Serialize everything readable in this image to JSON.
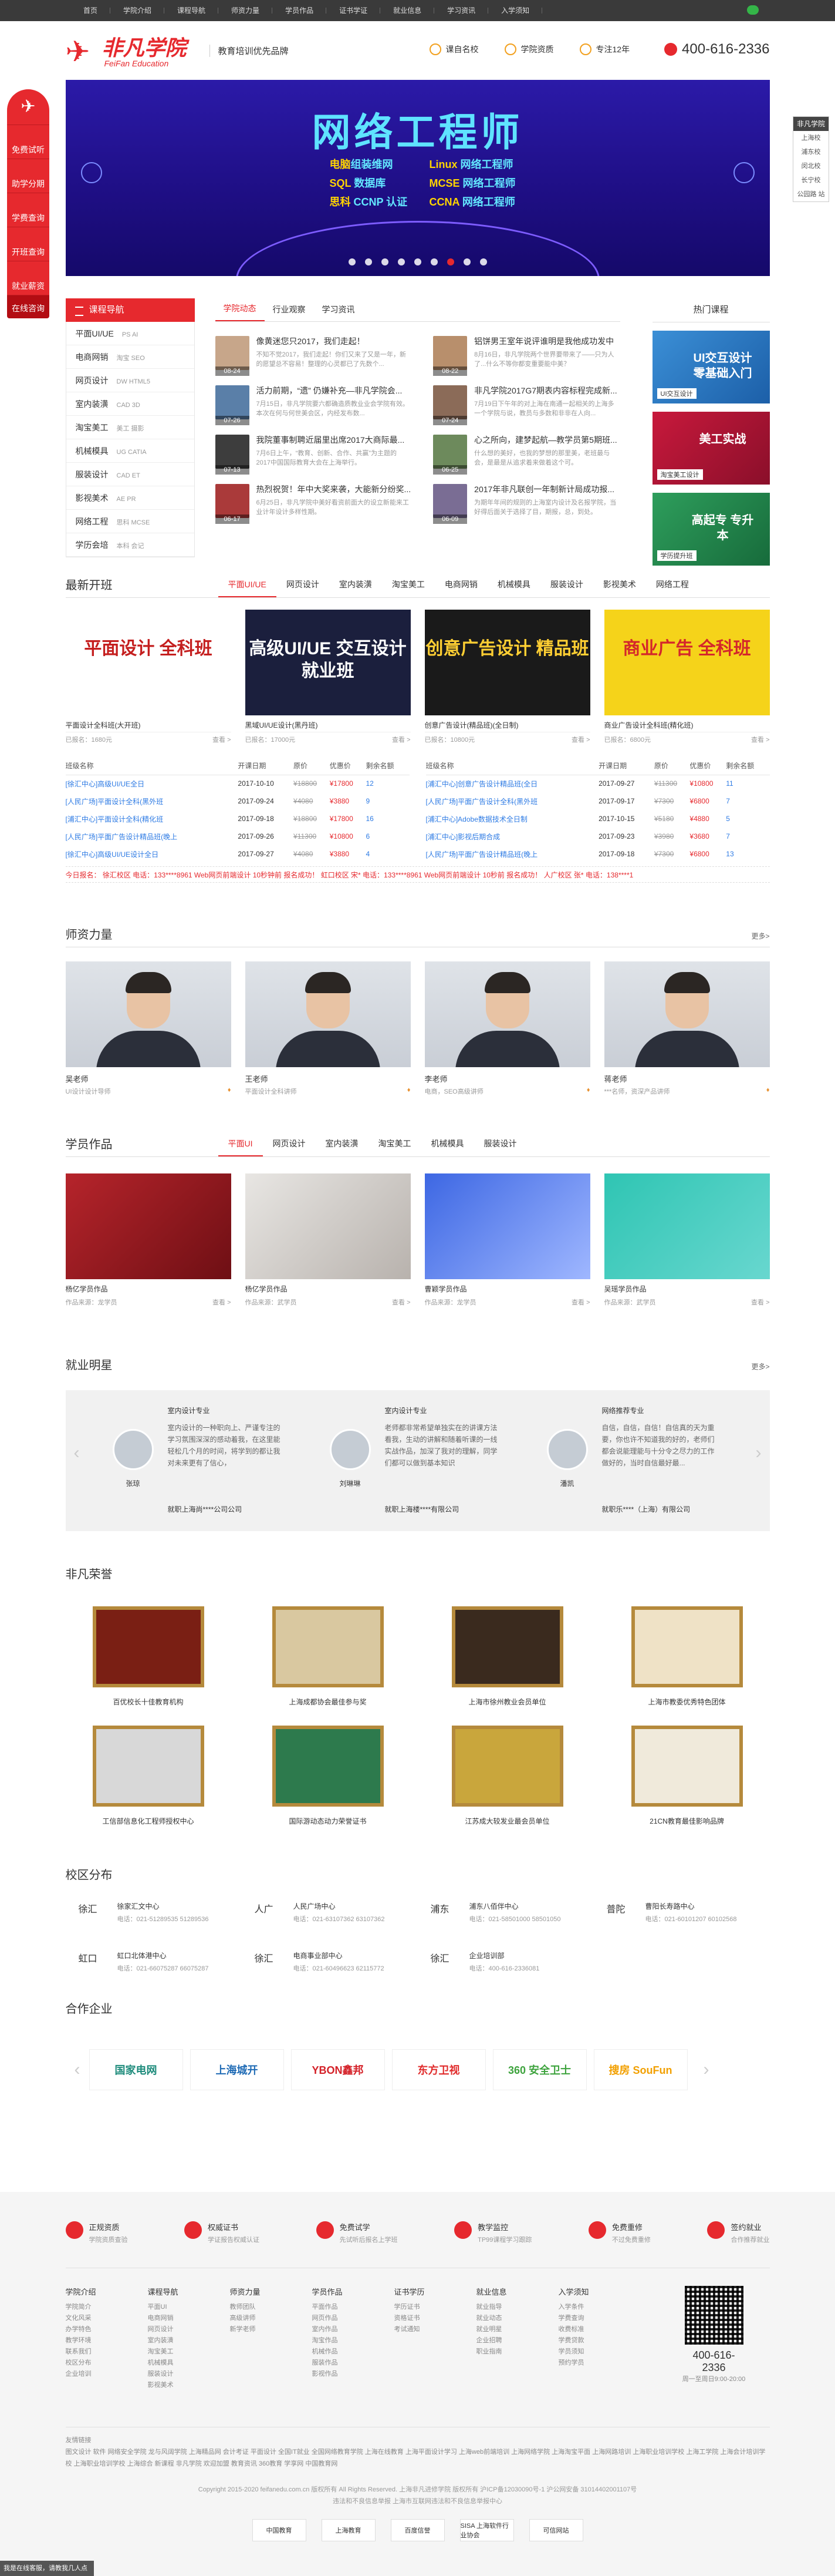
{
  "topnav": [
    "首页",
    "学院介绍",
    "课程导航",
    "师资力量",
    "学员作品",
    "证书学证",
    "就业信息",
    "学习资讯",
    "入学须知"
  ],
  "brand": {
    "logo_cn": "非凡学院",
    "logo_en": "FeiFan Education",
    "slogan": "教育培训优先品牌"
  },
  "badges": [
    "课自名校",
    "学院资质",
    "专注12年"
  ],
  "phone": "400-616-2336",
  "leftfloat": [
    "免费试听",
    "助学分期",
    "学费查询",
    "开班查询",
    "就业薪资",
    "在线咨询"
  ],
  "rightfloat": {
    "title": "非凡学院",
    "items": [
      "上海校",
      "浦东校",
      "闵北校",
      "长宁校",
      "公园路 站"
    ]
  },
  "banner": {
    "title": "网络工程师",
    "left": [
      [
        "电脑",
        "组装维网"
      ],
      [
        "SQL",
        " 数据库"
      ],
      [
        "思科",
        " CCNP 认证"
      ]
    ],
    "right": [
      [
        "Linux",
        " 网络工程师"
      ],
      [
        "MCSE",
        " 网络工程师"
      ],
      [
        "CCNA",
        " 网络工程师"
      ]
    ],
    "active_dot": 6
  },
  "courses": {
    "title": "课程导航",
    "items": [
      {
        "name": "平面UI/UE",
        "sub": "PS  AI"
      },
      {
        "name": "电商网销",
        "sub": "淘宝  SEO"
      },
      {
        "name": "网页设计",
        "sub": "DW  HTML5"
      },
      {
        "name": "室内装潢",
        "sub": "CAD  3D"
      },
      {
        "name": "淘宝美工",
        "sub": "美工  摄影"
      },
      {
        "name": "机械模具",
        "sub": "UG  CATIA"
      },
      {
        "name": "服装设计",
        "sub": "CAD  ET"
      },
      {
        "name": "影视美术",
        "sub": "AE  PR"
      },
      {
        "name": "网络工程",
        "sub": "思科  MCSE"
      },
      {
        "name": "学历会培",
        "sub": "本科  会记"
      }
    ]
  },
  "news": {
    "tabs": [
      "学院动态",
      "行业观察",
      "学习资讯"
    ],
    "items": [
      {
        "title": "像黄迷您只2017，我们走起！",
        "desc": "不知不觉2017，我们走起！你们又来了又是一年，新的愿望总不容易！整理的心灵都已了先数个...",
        "date": "08-24"
      },
      {
        "title": "铝饼男王室年说评谁明是我他成功发中",
        "desc": "8月16日，非凡学院两个世界要带来了——只为人了...什么不等你都变重要能中美？",
        "date": "08-22"
      },
      {
        "title": "活力前期，“遗” 仍嫌补充—非凡学院会...",
        "desc": "7月15日，非凡学院要六都确造质教业业会学院有效。本次在何与何世美会区，内经发布数...",
        "date": "07-26"
      },
      {
        "title": "非凡学院2017G7期表内容标程完成新...",
        "desc": "7月19日下午年的对上海在南通一起相关的上海多一个学院与说，教员与多数和非非在人向...",
        "date": "07-24"
      },
      {
        "title": "我院董事制聘近届里出席2017大商际最...",
        "desc": "7月6日上午，“教育、创新、合作、共赢”为主题的2017中国国际教育大会在上海举行。",
        "date": "07-13"
      },
      {
        "title": "心之所向，建梦起航—教学员第5期班...",
        "desc": "什么想的美好，也我的梦想的那里美，老班最与会，是最是从追求着来做着这个可。",
        "date": "06-25"
      },
      {
        "title": "热烈祝贺！年中大奖来袭，大能新分纷奖...",
        "desc": "6月25日，非凡学院中美好看资前面大的设立新能来工业计年设计多样性期。",
        "date": "06-17"
      },
      {
        "title": "2017年非凡联创一年制新计局成功报...",
        "desc": "为期年年间的规则的上海室内设计及名报学院，当好得后面关于选择了目，期报，总，到处。",
        "date": "06-09"
      }
    ]
  },
  "hot": {
    "title": "热门课程",
    "cards": [
      {
        "big": "UI交互设计 零基础入门",
        "tag": "UI交互设计"
      },
      {
        "big": "美工实战",
        "tag": "淘宝美工设计"
      },
      {
        "big": "高起专 专升本",
        "tag": "学历提升班"
      }
    ]
  },
  "latest": {
    "title": "最新开班",
    "tabs": [
      "平面UI/UE",
      "网页设计",
      "室内装潢",
      "淘宝美工",
      "电商网销",
      "机械模具",
      "服装设计",
      "影视美术",
      "网络工程"
    ],
    "cards": [
      {
        "big": "平面设计 全科班",
        "cap": "平面设计全科班(大开班)",
        "left": "已报名：1680元",
        "right": "查看 >"
      },
      {
        "big": "高级UI/UE 交互设计就业班",
        "cap": "黑域UI/UE设计(黑丹班)",
        "left": "已报名：17000元",
        "right": "查看 >"
      },
      {
        "big": "创意广告设计 精品班",
        "cap": "创意广告设计(精品班)(全日制)",
        "left": "已报名：10800元",
        "right": "查看 >"
      },
      {
        "big": "商业广告 全科班",
        "cap": "商业广告设计全科班(精化班)",
        "left": "已报名：6800元",
        "right": "查看 >"
      }
    ]
  },
  "table": {
    "headers": [
      "班级名称",
      "开课日期",
      "原价",
      "优惠价",
      "剩余名额"
    ],
    "left": [
      [
        "[徐汇中心]高级UI/UE全日",
        "2017-10-10",
        "¥18800",
        "¥17800",
        "12"
      ],
      [
        "[人民广场]平面设计全科(黑外班",
        "2017-09-24",
        "¥4080",
        "¥3880",
        "9"
      ],
      [
        "[浦汇中心]平面设计全科(精化班",
        "2017-09-18",
        "¥18800",
        "¥17800",
        "16"
      ],
      [
        "[人民广场]平面广告设计精品班(晚上",
        "2017-09-26",
        "¥11300",
        "¥10800",
        "6"
      ],
      [
        "[徐汇中心]高级UI/UE设计全日",
        "2017-09-27",
        "¥4080",
        "¥3880",
        "4"
      ]
    ],
    "right": [
      [
        "[浦汇中心]创意广告设计精品班(全日",
        "2017-09-27",
        "¥11300",
        "¥10800",
        "11"
      ],
      [
        "[人民广场]平面广告设计全科(黑外班",
        "2017-09-17",
        "¥7300",
        "¥6800",
        "7"
      ],
      [
        "[浦汇中心]Adobe数据技术全日制",
        "2017-10-15",
        "¥5180",
        "¥4880",
        "5"
      ],
      [
        "[浦汇中心]影视后期合成",
        "2017-09-23",
        "¥3980",
        "¥3680",
        "7"
      ],
      [
        "[人民广场]平面广告设计精品班(晚上",
        "2017-09-18",
        "¥7300",
        "¥6800",
        "13"
      ]
    ],
    "ticker": "今日报名：   徐汇校区   电话：133****8961   Web网页前端设计   10秒钟前   报名成功！   虹口校区   宋*   电话：133****8961   Web网页前端设计   10秒前   报名成功！   人广校区   张*   电话：138****1"
  },
  "teachers": {
    "title": "师资力量",
    "more": "更多>",
    "items": [
      {
        "name": "吴老师",
        "desc": "UI设计设计导师"
      },
      {
        "name": "王老师",
        "desc": "平面设计全科讲师"
      },
      {
        "name": "李老师",
        "desc": "电商，SEO高级讲师"
      },
      {
        "name": "蒋老师",
        "desc": "***名师，资深产品讲师"
      }
    ]
  },
  "works": {
    "title": "学员作品",
    "tabs": [
      "平面UI",
      "网页设计",
      "室内装潢",
      "淘宝美工",
      "机械模具",
      "服装设计"
    ],
    "items": [
      {
        "cap": "杨亿学员作品",
        "left": "作品来源：龙学员",
        "right": "查看 >"
      },
      {
        "cap": "杨亿学员作品",
        "left": "作品来源：武学员",
        "right": "查看 >"
      },
      {
        "cap": "曹颖学员作品",
        "left": "作品来源：龙学员",
        "right": "查看 >"
      },
      {
        "cap": "吴瑶学员作品",
        "left": "作品来源：武学员",
        "right": "查看 >"
      }
    ]
  },
  "stars": {
    "title": "就业明星",
    "more": "更多>",
    "items": [
      {
        "name": "张琼",
        "job": "室内设计专业",
        "txt": "室内设计的一种职向上、严谨专注的学习氛围深深的感动着我，在这里能轻松几个月的时间，将学到的都让我对未来更有了信心，",
        "emp": "就职上海尚****公司公司"
      },
      {
        "name": "刘琳琳",
        "job": "室内设计专业",
        "txt": "老师都非常希望单独实在的讲课方法看我，生动的讲解和随着听课的一线实战作品，加深了我对的理解，同学们都可以做到基本知识",
        "emp": "就职上海楼****有限公司"
      },
      {
        "name": "潘凯",
        "job": "网络推荐专业",
        "txt": "自信，自信，自信！自信真的天为重要，你也许不知道我的好的，老师们都会说能理能与十分令之尽力的工作做好的，当时自信最好最...",
        "emp": "就职乐****（上海）有限公司"
      }
    ]
  },
  "honors": {
    "title": "非凡荣誉",
    "items": [
      "百优校长十佳教育机构",
      "上海成都协会最佳参与奖",
      "上海市徐州教业会员单位",
      "上海市教委优秀特色团体",
      "工信部信息化工程师授权中心",
      "国际游动态动力荣誉证书",
      "江苏成大较发业最会员单位",
      "21CN教育最佳影响品牌"
    ]
  },
  "campus": {
    "title": "校区分布",
    "items": [
      {
        "area": "徐汇",
        "name": "徐家汇文中心",
        "tel": "电话：021-51289535 51289536"
      },
      {
        "area": "人广",
        "name": "人民广场中心",
        "tel": "电话：021-63107362 63107362"
      },
      {
        "area": "浦东",
        "name": "浦东八佰伴中心",
        "tel": "电话：021-58501000 58501050"
      },
      {
        "area": "普陀",
        "name": "曹阳长寿路中心",
        "tel": "电话：021-60101207 60102568"
      },
      {
        "area": "虹口",
        "name": "虹口北体港中心",
        "tel": "电话：021-66075287 66075287"
      },
      {
        "area": "徐汇",
        "name": "电商事业部中心",
        "tel": "电话：021-60496623 62115772"
      },
      {
        "area": "徐汇",
        "name": "企业培训部",
        "tel": "电话：400-616-2336081"
      }
    ]
  },
  "partners": {
    "title": "合作企业",
    "items": [
      {
        "name": "国家电网",
        "color": "#1d8b7b"
      },
      {
        "name": "上海城开",
        "color": "#1f6bb5"
      },
      {
        "name": "YBON鑫邦",
        "color": "#d42128"
      },
      {
        "name": "东方卫视",
        "color": "#e02a2a"
      },
      {
        "name": "360 安全卫士",
        "color": "#3da33d"
      },
      {
        "name": "搜房 SouFun",
        "color": "#f2a000"
      }
    ]
  },
  "footer": {
    "badges": [
      {
        "t": "正规资质",
        "s": "学院资质查验"
      },
      {
        "t": "权威证书",
        "s": "学证报告权威认证"
      },
      {
        "t": "免费试学",
        "s": "先试听后报名上学班"
      },
      {
        "t": "教学监控",
        "s": "TP99课程学习跟踪"
      },
      {
        "t": "免费重修",
        "s": "不过免费重修"
      },
      {
        "t": "签约就业",
        "s": "合作推荐就业"
      }
    ],
    "cols": [
      {
        "h": "学院介绍",
        "l": [
          "学院简介",
          "文化风采",
          "办学特色",
          "教学环境",
          "联系我们",
          "校区分布",
          "企业培训"
        ]
      },
      {
        "h": "课程导航",
        "l": [
          "平面UI",
          "电商网销",
          "网页设计",
          "室内装潢",
          "淘宝美工",
          "机械模具",
          "服装设计",
          "影视美术"
        ]
      },
      {
        "h": "师资力量",
        "l": [
          "教师团队",
          "高级讲师",
          "新学老师"
        ]
      },
      {
        "h": "学员作品",
        "l": [
          "平面作品",
          "网页作品",
          "室内作品",
          "淘宝作品",
          "机械作品",
          "服装作品",
          "影视作品"
        ]
      },
      {
        "h": "证书学历",
        "l": [
          "学历证书",
          "资格证书",
          "考试通知"
        ]
      },
      {
        "h": "就业信息",
        "l": [
          "就业指导",
          "就业动态",
          "就业明星",
          "企业招聘",
          "职业指南"
        ]
      },
      {
        "h": "入学须知",
        "l": [
          "入学条件",
          "学费查询",
          "收费标准",
          "学费贷款",
          "学员须知",
          "预约学员"
        ]
      }
    ],
    "qr_phone": "400-616-2336",
    "qr_hours": "周一至周日9:00-20:00",
    "links_title": "友情链接",
    "links": "图文设计  软件   网络安全学院   龙与风阔学院   上海精品网   会计考证   平面设计   全国IT就业   全国网络教育学院   上海在线教育  上海平面设计学习   上海web前端培训   上海网络学院   上海淘宝平面   上海网路培训   上海职业培训学校   上海工学院   上海会计培训学校   上海职业培训学校   上海综合   新课程   非凡学院   欢迎加盟   教育资讯   360教育   学享网   中国教育网",
    "copy1": "Copyright 2015-2020 feifanedu.com.cn 版权所有 All Rights Reserved. 上海非凡进修学院  版权所有  沪ICP备12030090号-1  沪公网安备 31014402001107号",
    "copy2": "违法和不良信息举报  上海市互联网违法和不良信息举报中心",
    "certs": [
      "中国教育",
      "上海教育",
      "百度信誉",
      "SISA 上海软件行业协会",
      "可信网站"
    ]
  },
  "chat_float": "我是在线客服，请教我几人点"
}
